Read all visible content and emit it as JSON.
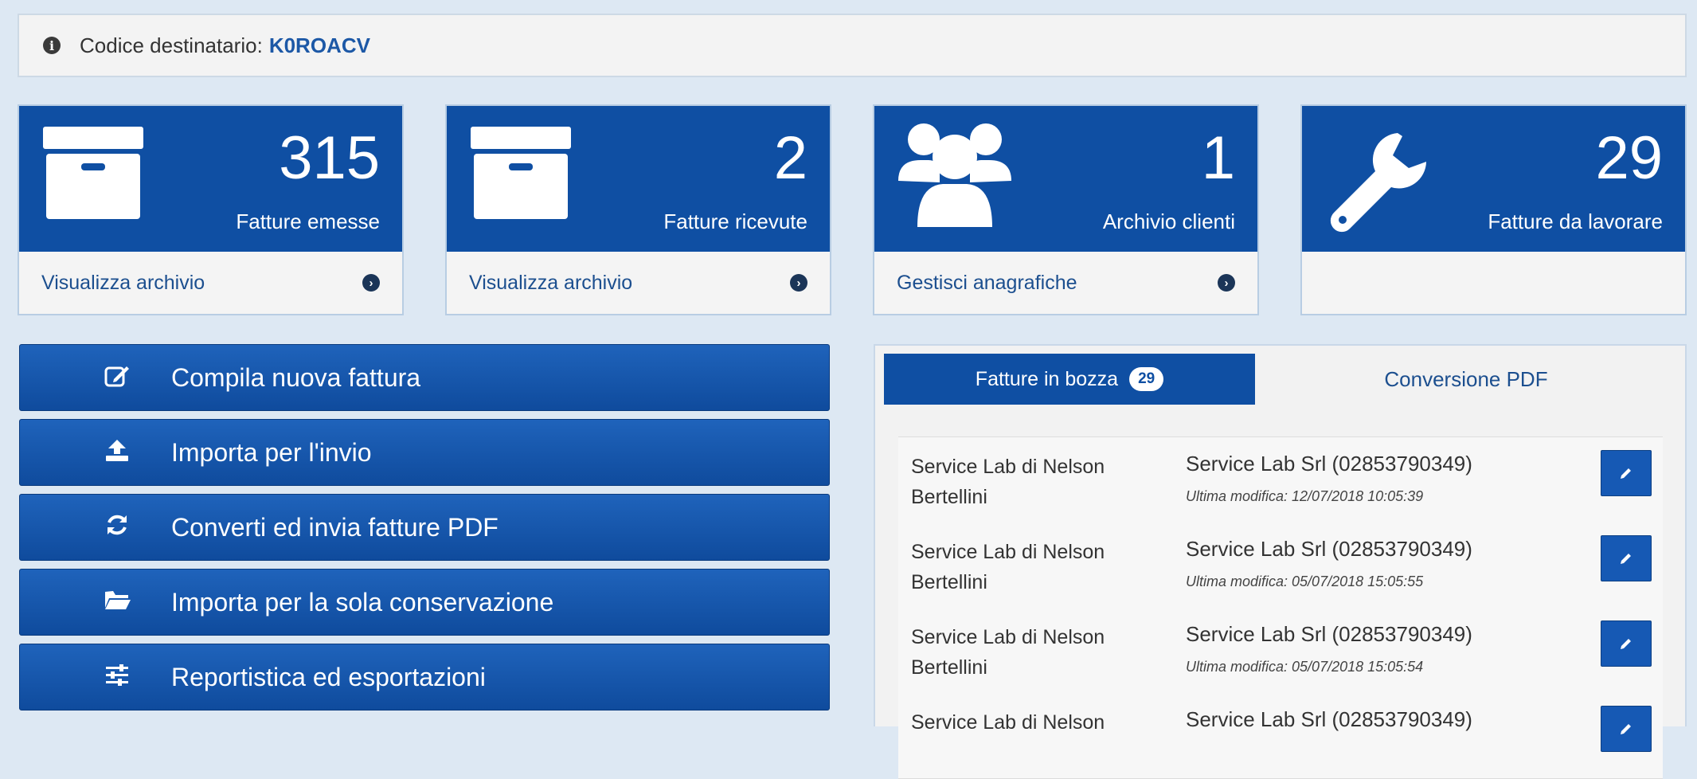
{
  "info": {
    "label": "Codice destinatario:",
    "code": "K0ROACV"
  },
  "cards": [
    {
      "count": "315",
      "label": "Fatture emesse",
      "link": "Visualizza archivio",
      "icon": "archive-box-icon"
    },
    {
      "count": "2",
      "label": "Fatture ricevute",
      "link": "Visualizza archivio",
      "icon": "archive-box-icon"
    },
    {
      "count": "1",
      "label": "Archivio clienti",
      "link": "Gestisci anagrafiche",
      "icon": "users-group-icon"
    },
    {
      "count": "29",
      "label": "Fatture da lavorare",
      "link": "",
      "icon": "wrench-icon"
    }
  ],
  "actions": [
    {
      "label": "Compila nuova fattura",
      "icon": "edit-icon"
    },
    {
      "label": "Importa per l'invio",
      "icon": "upload-icon"
    },
    {
      "label": "Converti ed invia fatture PDF",
      "icon": "refresh-icon"
    },
    {
      "label": "Importa per la sola conservazione",
      "icon": "folder-open-icon"
    },
    {
      "label": "Reportistica ed esportazioni",
      "icon": "sliders-icon"
    }
  ],
  "tabs": {
    "active": {
      "label": "Fatture in bozza",
      "badge": "29"
    },
    "inactive": {
      "label": "Conversione PDF"
    }
  },
  "drafts": [
    {
      "sender": "Service Lab di Nelson Bertellini",
      "client": "Service Lab Srl (02853790349)",
      "modified": "Ultima modifica: 12/07/2018 10:05:39"
    },
    {
      "sender": "Service Lab di Nelson Bertellini",
      "client": "Service Lab Srl (02853790349)",
      "modified": "Ultima modifica: 05/07/2018 15:05:55"
    },
    {
      "sender": "Service Lab di Nelson Bertellini",
      "client": "Service Lab Srl (02853790349)",
      "modified": "Ultima modifica: 05/07/2018 15:05:54"
    },
    {
      "sender": "Service Lab di Nelson",
      "client": "Service Lab Srl (02853790349)",
      "modified": ""
    }
  ],
  "colors": {
    "primary": "#0f4fa3",
    "link": "#1c4f8f",
    "background": "#dde8f3"
  }
}
